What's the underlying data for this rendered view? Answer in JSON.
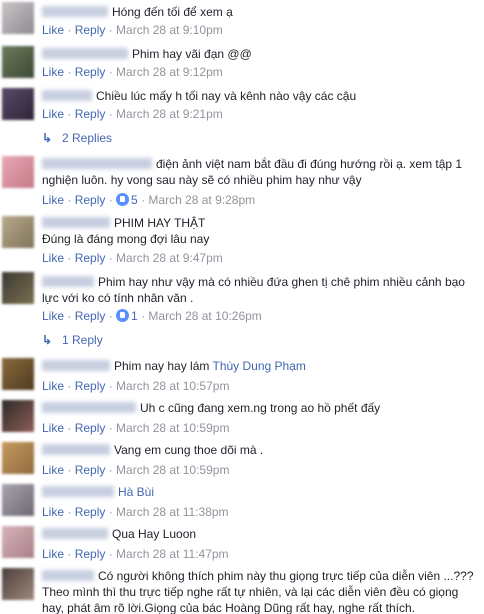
{
  "actions": {
    "like": "Like",
    "reply": "Reply",
    "sep": " · "
  },
  "comments": [
    {
      "text": "Hóng đến tối để xem ạ",
      "time": "March 28 at 9:10pm"
    },
    {
      "text": "Phim hay vãi đạn @@",
      "time": "March 28 at 9:12pm"
    },
    {
      "text": "Chiều lúc mấy h tối nay và kênh nào vậy các cậu",
      "time": "March 28 at 9:21pm"
    },
    {
      "text": "điện ảnh việt nam bắt đầu đi đúng hướng rồi ạ. xem tập 1 nghiện luôn. hy vong sau này sẽ có nhiều phim hay như vậy",
      "time": "March 28 at 9:28pm",
      "likes": "5"
    },
    {
      "text": "PHIM HAY THẬT",
      "text2": "Đúng là đáng mong đợi lâu nay",
      "time": "March 28 at 9:47pm"
    },
    {
      "text": "Phim hay như vậy mà có nhiều đứa ghen tị chê phim nhiều cảnh bạo lực với ko có tính nhân văn .",
      "time": "March 28 at 10:26pm",
      "likes": "1"
    },
    {
      "text": "Phim nay hay lám ",
      "tag": "Thùy Dung Phạm",
      "time": "March 28 at 10:57pm"
    },
    {
      "text": "Uh c cũng đang xem.ng trong ao hồ phết đấy",
      "time": "March 28 at 10:59pm"
    },
    {
      "text": "Vang em cung thoe dõi mà .",
      "time": "March 28 at 10:59pm"
    },
    {
      "text": "",
      "tag": "Hà Bùi",
      "time": "March 28 at 11:38pm"
    },
    {
      "text": "Qua Hay Luoon",
      "time": "March 28 at 11:47pm"
    },
    {
      "text": "Có người không thích phim này thu giọng trực tiếp của diễn viên ...???Theo mình thì thu trực tiếp nghe rất tự nhiên, và lại các diễn viên đều có giọng hay, phát âm rõ lời.Giọng của bác Hoàng Dũng rất hay, nghe rất thích."
    }
  ],
  "replies": [
    {
      "label": "2 Replies"
    },
    {
      "label": "1 Reply"
    }
  ],
  "colors": {
    "link": "#4267b2",
    "meta": "#90949c",
    "text": "#1d2129",
    "like_badge": "#5890ff"
  }
}
